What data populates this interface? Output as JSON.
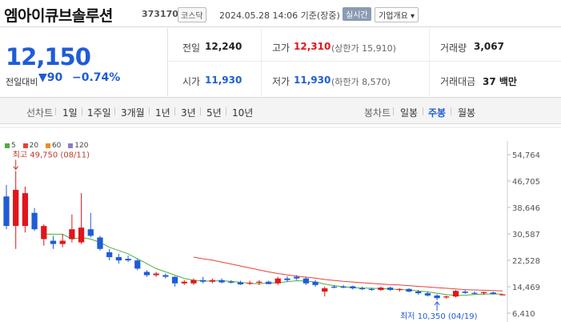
{
  "header": {
    "name": "엠아이큐브솔루션",
    "code": "373170",
    "market": "코스닥",
    "datetime": "2024.05.28 14:06  기준(장중)",
    "live_badge": "실시간",
    "corp_button": "기업개요 ▾"
  },
  "price": {
    "current": "12,150",
    "diff_label": "전일대비",
    "diff_value": "▼90",
    "diff_pct": "−0.74%"
  },
  "stats": {
    "prev_close_label": "전일",
    "prev_close": "12,240",
    "high_label": "고가",
    "high": "12,310",
    "upper_limit": "(상한가 15,910)",
    "volume_label": "거래량",
    "volume": "3,067",
    "open_label": "시가",
    "open": "11,930",
    "low_label": "저가",
    "low": "11,930",
    "lower_limit": "(하한가 8,570)",
    "trade_value_label": "거래대금",
    "trade_value": "37 백만"
  },
  "toolbar": {
    "line_chart_label": "선차트",
    "line_periods": [
      "1일",
      "1주일",
      "3개월",
      "1년",
      "3년",
      "5년",
      "10년"
    ],
    "candle_chart_label": "봉차트",
    "candle_periods": [
      "일봉",
      "주봉",
      "월봉"
    ],
    "active_candle": "주봉"
  },
  "colors": {
    "up": "#e0161b",
    "down": "#1f5cd6",
    "ma5": "#4caf3c",
    "ma20": "#e8413a",
    "ma60": "#f28c1c",
    "ma120": "#8a7ccc"
  },
  "chart_data": {
    "type": "candlestick",
    "legend": [
      {
        "name": "5",
        "color": "#4caf3c"
      },
      {
        "name": "20",
        "color": "#e8413a"
      },
      {
        "name": "60",
        "color": "#f28c1c"
      },
      {
        "name": "120",
        "color": "#8a7ccc"
      }
    ],
    "y_ticks": [
      "54,764",
      "46,705",
      "38,646",
      "30,587",
      "22,528",
      "14,469",
      "6,410"
    ],
    "ylim": [
      6410,
      54764
    ],
    "max_annotation": "최고 49,750 (08/11)",
    "min_annotation": "최저 10,350 (04/19)",
    "max_value": 49750,
    "min_value": 10350,
    "candles": [
      {
        "o": 42000,
        "h": 45500,
        "l": 32000,
        "c": 33000
      },
      {
        "o": 33000,
        "h": 49750,
        "l": 26000,
        "c": 44000
      },
      {
        "o": 33000,
        "h": 45000,
        "l": 31000,
        "c": 43000
      },
      {
        "o": 37000,
        "h": 38500,
        "l": 31500,
        "c": 32000
      },
      {
        "o": 29000,
        "h": 33500,
        "l": 27000,
        "c": 33000
      },
      {
        "o": 28500,
        "h": 30000,
        "l": 26000,
        "c": 27500
      },
      {
        "o": 27500,
        "h": 30500,
        "l": 26500,
        "c": 28500
      },
      {
        "o": 29000,
        "h": 36500,
        "l": 28000,
        "c": 32000
      },
      {
        "o": 28000,
        "h": 43000,
        "l": 27500,
        "c": 32500
      },
      {
        "o": 32000,
        "h": 37000,
        "l": 29500,
        "c": 30000
      },
      {
        "o": 29500,
        "h": 30000,
        "l": 25500,
        "c": 26000
      },
      {
        "o": 25000,
        "h": 26000,
        "l": 22500,
        "c": 23500
      },
      {
        "o": 23500,
        "h": 24500,
        "l": 21500,
        "c": 22500
      },
      {
        "o": 23000,
        "h": 24000,
        "l": 22000,
        "c": 22500
      },
      {
        "o": 22500,
        "h": 23000,
        "l": 19500,
        "c": 20000
      },
      {
        "o": 19000,
        "h": 19500,
        "l": 17500,
        "c": 18000
      },
      {
        "o": 18000,
        "h": 19000,
        "l": 17500,
        "c": 18500
      },
      {
        "o": 18000,
        "h": 18500,
        "l": 17000,
        "c": 17500
      },
      {
        "o": 17500,
        "h": 17700,
        "l": 14500,
        "c": 15500
      },
      {
        "o": 15500,
        "h": 16500,
        "l": 15000,
        "c": 16000
      },
      {
        "o": 15500,
        "h": 17000,
        "l": 15000,
        "c": 16500
      },
      {
        "o": 16500,
        "h": 17500,
        "l": 15500,
        "c": 16000
      },
      {
        "o": 16000,
        "h": 17000,
        "l": 15500,
        "c": 16500
      },
      {
        "o": 16500,
        "h": 17000,
        "l": 15500,
        "c": 15800
      },
      {
        "o": 16000,
        "h": 16500,
        "l": 15500,
        "c": 15800
      },
      {
        "o": 15800,
        "h": 16300,
        "l": 15000,
        "c": 15200
      },
      {
        "o": 15500,
        "h": 16300,
        "l": 15000,
        "c": 15700
      },
      {
        "o": 15700,
        "h": 16500,
        "l": 15000,
        "c": 16000
      },
      {
        "o": 16000,
        "h": 16300,
        "l": 15200,
        "c": 15300
      },
      {
        "o": 15500,
        "h": 17500,
        "l": 15000,
        "c": 17000
      },
      {
        "o": 17000,
        "h": 17700,
        "l": 16000,
        "c": 16500
      },
      {
        "o": 17500,
        "h": 18000,
        "l": 16500,
        "c": 17000
      },
      {
        "o": 17000,
        "h": 17500,
        "l": 15000,
        "c": 15500
      },
      {
        "o": 16000,
        "h": 16500,
        "l": 14500,
        "c": 15000
      },
      {
        "o": 13000,
        "h": 14500,
        "l": 11500,
        "c": 14000
      },
      {
        "o": 14500,
        "h": 15000,
        "l": 14000,
        "c": 14200
      },
      {
        "o": 14500,
        "h": 15000,
        "l": 14000,
        "c": 14200
      },
      {
        "o": 14600,
        "h": 14800,
        "l": 13600,
        "c": 14000
      },
      {
        "o": 14000,
        "h": 14500,
        "l": 13500,
        "c": 13800
      },
      {
        "o": 13800,
        "h": 14200,
        "l": 13200,
        "c": 13500
      },
      {
        "o": 13500,
        "h": 14500,
        "l": 13200,
        "c": 14200
      },
      {
        "o": 14200,
        "h": 14500,
        "l": 13200,
        "c": 13500
      },
      {
        "o": 13500,
        "h": 14000,
        "l": 13000,
        "c": 13800
      },
      {
        "o": 13800,
        "h": 14000,
        "l": 12800,
        "c": 13000
      },
      {
        "o": 13000,
        "h": 13500,
        "l": 12000,
        "c": 12500
      },
      {
        "o": 12500,
        "h": 13000,
        "l": 11500,
        "c": 11800
      },
      {
        "o": 11800,
        "h": 12200,
        "l": 10350,
        "c": 11000
      },
      {
        "o": 11200,
        "h": 11800,
        "l": 10800,
        "c": 11500
      },
      {
        "o": 11500,
        "h": 13500,
        "l": 11200,
        "c": 13200
      },
      {
        "o": 13000,
        "h": 13500,
        "l": 12300,
        "c": 12600
      },
      {
        "o": 12600,
        "h": 13000,
        "l": 12100,
        "c": 12300
      },
      {
        "o": 12500,
        "h": 13000,
        "l": 12000,
        "c": 12800
      },
      {
        "o": 12700,
        "h": 13000,
        "l": 12100,
        "c": 12200
      },
      {
        "o": 11930,
        "h": 12310,
        "l": 11930,
        "c": 12150
      }
    ],
    "ma5": [
      null,
      null,
      null,
      null,
      30500,
      30500,
      30500,
      29000,
      29500,
      29000,
      28000,
      26500,
      25500,
      24500,
      23000,
      21500,
      20000,
      19000,
      18000,
      17000,
      16500,
      16200,
      16200,
      16300,
      16100,
      15800,
      15500,
      15400,
      15600,
      15700,
      16000,
      16300,
      16200,
      15900,
      15300,
      14800,
      14500,
      14200,
      14100,
      14000,
      13900,
      13800,
      13600,
      13500,
      13200,
      12900,
      12500,
      12100,
      11800,
      11900,
      12100,
      12200,
      12300,
      12200
    ],
    "ma20": [
      null,
      null,
      null,
      null,
      null,
      null,
      null,
      null,
      null,
      null,
      null,
      null,
      null,
      null,
      null,
      null,
      null,
      null,
      null,
      null,
      23500,
      23000,
      22600,
      22000,
      21400,
      20800,
      20200,
      19600,
      19000,
      18500,
      18100,
      17700,
      17400,
      17100,
      16700,
      16400,
      16100,
      15900,
      15700,
      15500,
      15300,
      15100,
      15000,
      14800,
      14600,
      14400,
      14200,
      14000,
      13800,
      13600,
      13500,
      13400,
      13300,
      13200
    ]
  }
}
